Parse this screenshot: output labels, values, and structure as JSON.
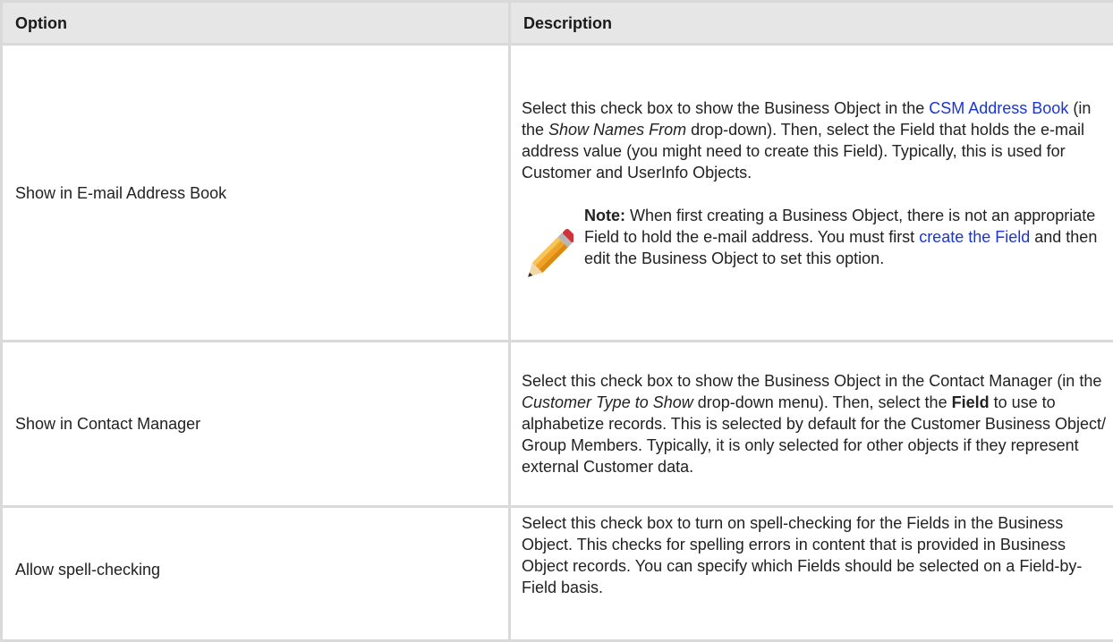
{
  "table": {
    "headers": {
      "option": "Option",
      "description": "Description"
    },
    "rows": [
      {
        "option": "Show in E-mail Address Book",
        "desc": {
          "t1": "Select this check box to show the Business Object in the ",
          "link1": "CSM Address Book",
          "t2": " (in the ",
          "em1": "Show Names From",
          "t3": " drop-down). Then, select the Field that holds the e-mail address value (you might need to create this Field). Typically, this is used for Customer and UserInfo Objects."
        },
        "note": {
          "label": "Note:",
          "t1": " When first creating a Business Object, there is not an appropriate Field to hold the e-mail address. You must first ",
          "link": "create the Field",
          "t2": " and then edit the Business Object to set this option."
        }
      },
      {
        "option": "Show in Contact Manager",
        "desc": {
          "t1": "Select this check box to show the Business Object in the Contact Manager (in the ",
          "em1": "Customer Type to Show",
          "t2": " drop-down menu). Then, select the ",
          "bold1": "Field",
          "t3": " to use to alphabetize records. This is selected by default for the Customer Business Object/ Group Members. Typically, it is only selected for other objects if they represent external Customer data."
        }
      },
      {
        "option": "Allow spell-checking",
        "desc": {
          "t1": "Select this check box to turn on spell-checking for the Fields in the Business Object. This checks for spelling errors in content that is provided in Business Object records. You can specify which Fields should be selected on a Field-by-Field basis."
        }
      }
    ]
  },
  "icons": {
    "note": "pencil-icon"
  },
  "colors": {
    "link": "#1a35d6",
    "header_bg": "#e6e6e6",
    "border": "#d9d9d9"
  }
}
